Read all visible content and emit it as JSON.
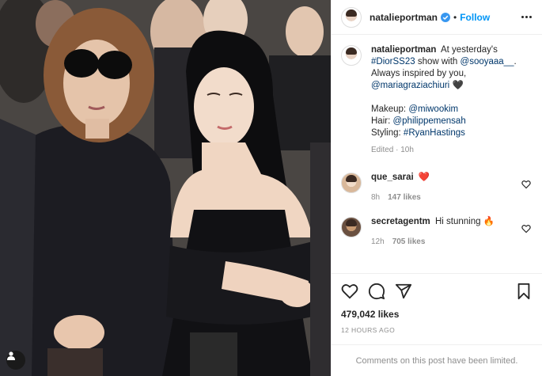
{
  "header": {
    "username": "natalieportman",
    "separator": "•",
    "follow_label": "Follow"
  },
  "caption": {
    "username": "natalieportman",
    "line1": "At yesterday's",
    "line2_tag": "#DiorSS23",
    "line2_text": " show with ",
    "line2_mention": "@sooyaaa__",
    "line2_end": ".",
    "line3": "Always inspired by you,",
    "line4_mention": "@mariagraziachiuri",
    "line4_emoji": "🖤",
    "makeup_label": "Makeup: ",
    "makeup_mention": "@miwookim",
    "hair_label": "Hair: ",
    "hair_mention": "@philippemensah",
    "styling_label": "Styling: ",
    "styling_tag": "#RyanHastings",
    "meta": "Edited · 10h"
  },
  "comments": [
    {
      "username": "que_sarai",
      "text": "❤️",
      "age": "8h",
      "likes": "147 likes"
    },
    {
      "username": "secretagentm",
      "text": "Hi stunning 🔥",
      "age": "12h",
      "likes": "705 likes"
    }
  ],
  "post": {
    "likes": "479,042 likes",
    "time_ago": "12 HOURS AGO",
    "comments_limited": "Comments on this post have been limited."
  },
  "colors": {
    "accent": "#0095f6",
    "link": "#00376b",
    "muted": "#8e8e8e",
    "text": "#262626",
    "verified": "#3897f0"
  },
  "icons": [
    "verified-icon",
    "more-options-icon",
    "heart-icon",
    "comment-icon",
    "share-icon",
    "save-icon",
    "user-tag-icon"
  ]
}
